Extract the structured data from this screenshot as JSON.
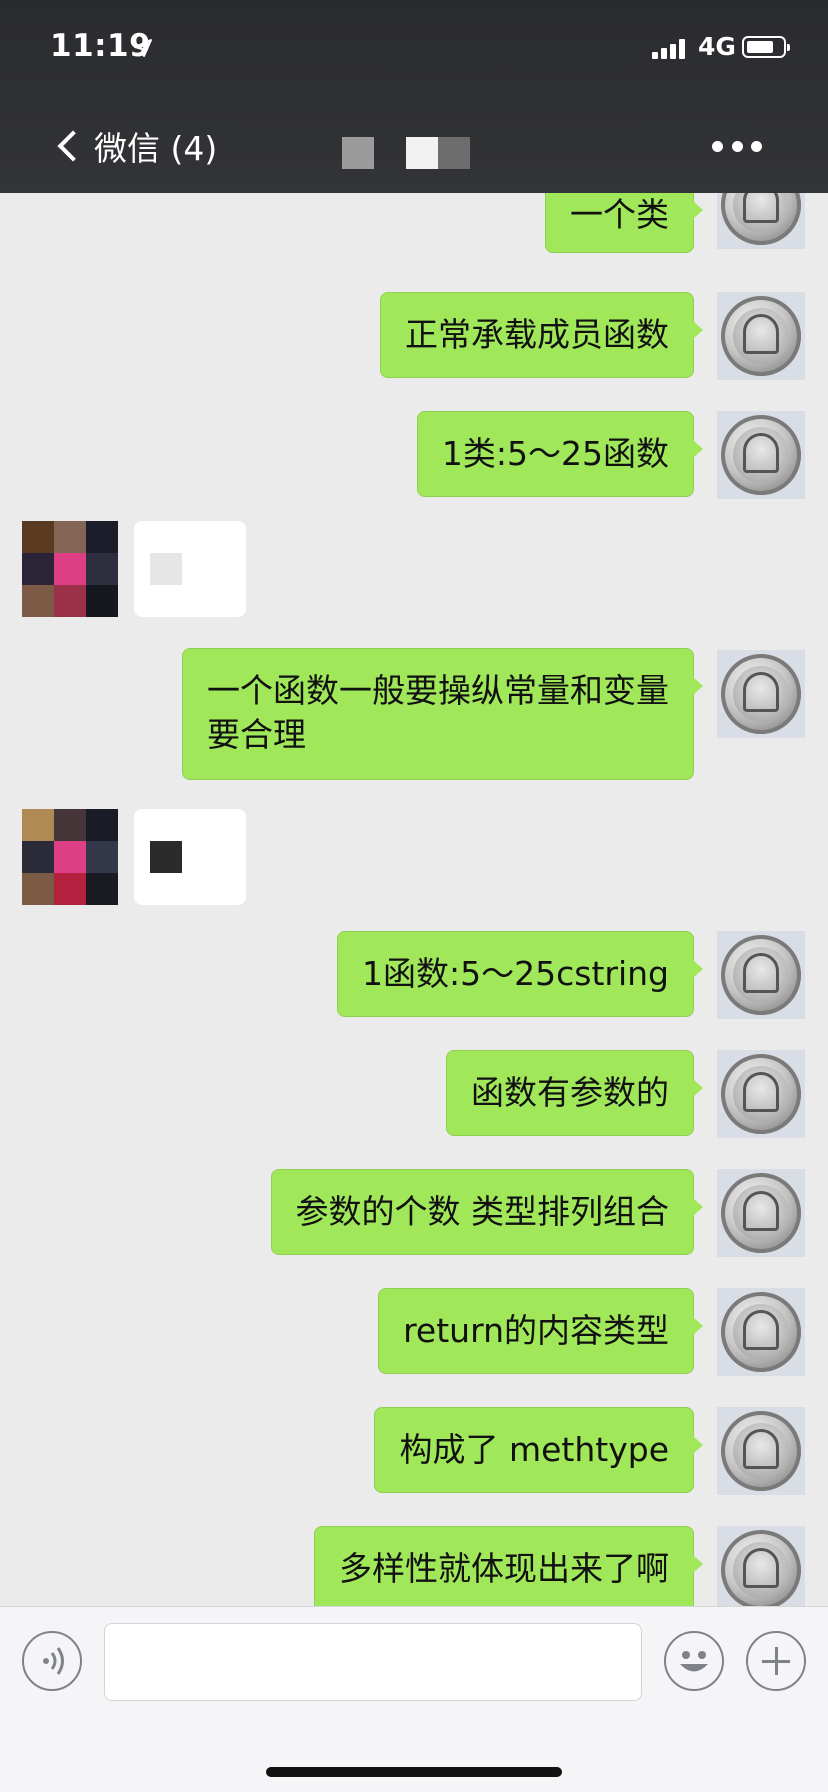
{
  "status_bar": {
    "time": "11:19",
    "network": "4G"
  },
  "nav": {
    "back_label": "微信 (4)"
  },
  "messages": [
    {
      "text": "一个类"
    },
    {
      "text": "正常承载成员函数"
    },
    {
      "text": "1类:5～25函数"
    },
    {
      "text": "一个函数一般要操纵常量和变量",
      "text2": "要合理"
    },
    {
      "text": "1函数:5～25cstring"
    },
    {
      "text": "函数有参数的"
    },
    {
      "text": "参数的个数 类型排列组合"
    },
    {
      "text": "return的内容类型"
    },
    {
      "text": "构成了 methtype"
    },
    {
      "text": "多样性就体现出来了啊"
    }
  ],
  "colors": {
    "nav_bg": "#2d2e31",
    "chat_bg": "#ebebeb",
    "my_bubble": "#a0e75a",
    "input_bar_bg": "#f5f5f7"
  },
  "icons": [
    "location-arrow-icon",
    "signal-icon",
    "battery-icon",
    "back-chevron-icon",
    "more-icon",
    "voice-icon",
    "emoji-icon",
    "plus-icon"
  ]
}
